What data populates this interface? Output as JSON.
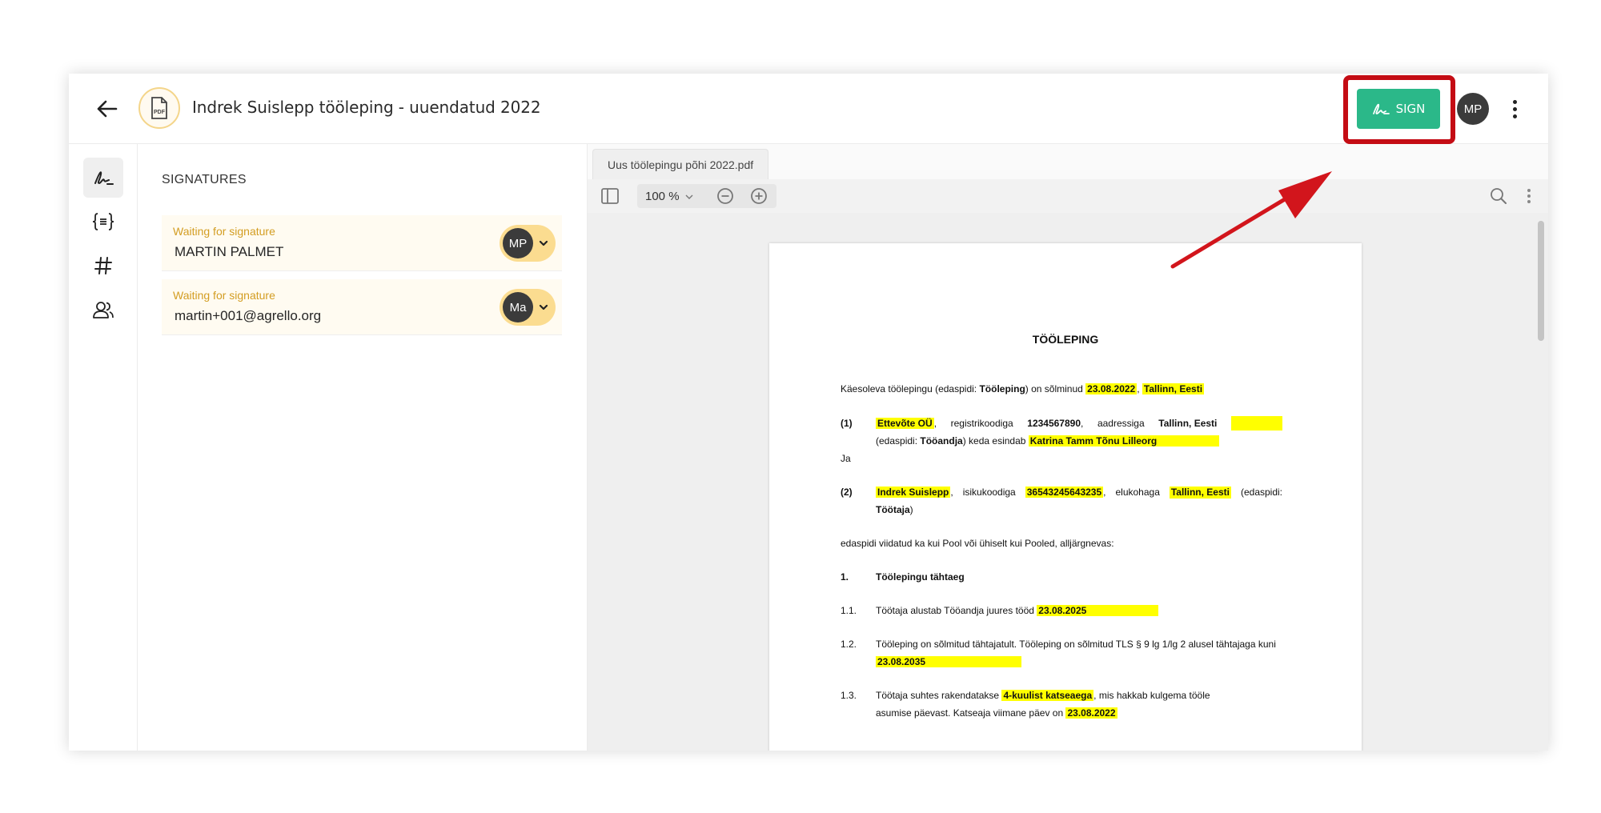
{
  "header": {
    "title": "Indrek Suislepp tööleping - uuendatud 2022",
    "pdf_badge_label": "PDF",
    "sign_label": "SIGN",
    "user_initials": "MP"
  },
  "rail": {
    "items": [
      "signature-icon",
      "variables-icon",
      "hash-icon",
      "users-icon"
    ]
  },
  "signatures": {
    "heading": "SIGNATURES",
    "items": [
      {
        "status": "Waiting for signature",
        "name": "MARTIN PALMET",
        "initials": "MP"
      },
      {
        "status": "Waiting for signature",
        "name": "martin+001@agrello.org",
        "initials": "Ma"
      }
    ]
  },
  "viewer": {
    "file_tab": "Uus töölepingu põhi 2022.pdf",
    "zoom": "100 %"
  },
  "document": {
    "title": "TÖÖLEPING",
    "intro_a": "Käesoleva töölepingu (edaspidi: ",
    "intro_b": "Tööleping",
    "intro_c": ") on sõlminud ",
    "intro_date": "23.08.2022",
    "intro_place": "Tallinn, Eesti",
    "p1_num": "(1)",
    "p1_company": "Ettevõte OÜ",
    "p1_reg_label": "registrikoodiga",
    "p1_reg": "1234567890",
    "p1_addr_label": "aadressiga",
    "p1_addr": "Tallinn, Eesti",
    "p1_line2_a": "(edaspidi: ",
    "p1_line2_b": "Tööandja",
    "p1_line2_c": ") keda esindab ",
    "p1_reps": "Katrina Tamm Tõnu Lilleorg",
    "ja": "Ja",
    "p2_num": "(2)",
    "p2_name": "Indrek Suislepp",
    "p2_id_label": "isikukoodiga",
    "p2_id": "36543245643235",
    "p2_res_label": "elukohaga",
    "p2_res": "Tallinn, Eesti",
    "p2_edaspidi": "(edaspidi:",
    "p2_line2_a": "Töötaja",
    "p2_line2_b": ")",
    "parties_line": "edaspidi viidatud ka kui Pool või ühiselt kui Pooled, alljärgnevas:",
    "s1_num": "1.",
    "s1_title": "Töölepingu tähtaeg",
    "s11_num": "1.1.",
    "s11_text": "Töötaja alustab Tööandja juures tööd ",
    "s11_date": "23.08.2025",
    "s12_num": "1.2.",
    "s12_text": "Tööleping on sõlmitud tähtajatult. Tööleping on sõlmitud TLS § 9 lg 1/lg 2 alusel tähtajaga kuni",
    "s12_date": "23.08.2035",
    "s13_num": "1.3.",
    "s13_a": "Töötaja  suhtes  rakendatakse ",
    "s13_trial": "4-kuulist katseaega",
    "s13_b": ",  mis  hakkab  kulgema  tööle",
    "s13_line2": "asumise päevast. Katseaja viimane päev on ",
    "s13_date": "23.08.2022"
  }
}
